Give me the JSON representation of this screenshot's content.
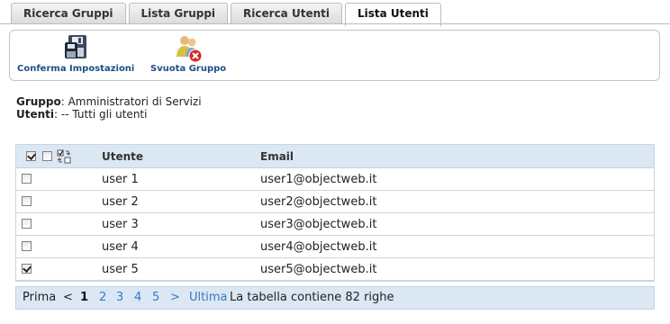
{
  "tabs": [
    {
      "label": "Ricerca Gruppi",
      "active": false
    },
    {
      "label": "Lista Gruppi",
      "active": false
    },
    {
      "label": "Ricerca Utenti",
      "active": false
    },
    {
      "label": "Lista Utenti",
      "active": true
    }
  ],
  "toolbar": {
    "confirm": {
      "label": "Conferma Impostazioni",
      "icon": "save-disk-icon"
    },
    "empty": {
      "label": "Svuota Gruppo",
      "icon": "remove-group-icon"
    }
  },
  "info": {
    "group_label": "Gruppo",
    "group_value": ": Amministratori di Servizi",
    "users_label": "Utenti",
    "users_value": ": -- Tutti gli utenti"
  },
  "table": {
    "columns": [
      "Utente",
      "Email"
    ],
    "rows": [
      {
        "user": "user 1",
        "email": "user1@objectweb.it",
        "checked": false
      },
      {
        "user": "user 2",
        "email": "user2@objectweb.it",
        "checked": false
      },
      {
        "user": "user 3",
        "email": "user3@objectweb.it",
        "checked": false
      },
      {
        "user": "user 4",
        "email": "user4@objectweb.it",
        "checked": false
      },
      {
        "user": "user 5",
        "email": "user5@objectweb.it",
        "checked": true
      }
    ]
  },
  "pager": {
    "first": "Prima",
    "prev": "<",
    "current": "1",
    "pages": [
      "2",
      "3",
      "4",
      "5"
    ],
    "next": ">",
    "last": "Ultima",
    "summary": "La tabella contiene 82 righe"
  },
  "colors": {
    "accent": "#3a78c0",
    "header_bg": "#dbe8f4",
    "toolbar_label": "#1f4e84"
  }
}
